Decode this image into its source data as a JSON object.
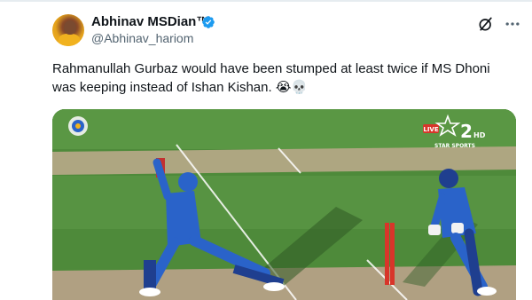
{
  "author": {
    "display_name": "Abhinav MSDian™",
    "handle": "@Abhinav_hariom",
    "verified": true
  },
  "tweet": {
    "text": "Rahmanullah Gurbaz would have been stumped at least twice if MS Dhoni was keeping instead of Ishan Kishan. 😭💀"
  },
  "media": {
    "broadcast_live_label": "LIVE",
    "broadcast_channel": "2",
    "broadcast_channel_suffix": "HD",
    "broadcast_network": "STAR SPORTS"
  },
  "icons": {
    "grok": "grok-icon",
    "more": "more-options-icon",
    "verified": "verified-badge-icon"
  },
  "colors": {
    "verified_blue": "#1d9bf0",
    "muted_text": "#536471",
    "pitch_green": "#4f8a3c",
    "jersey_blue": "#2a63c9"
  }
}
